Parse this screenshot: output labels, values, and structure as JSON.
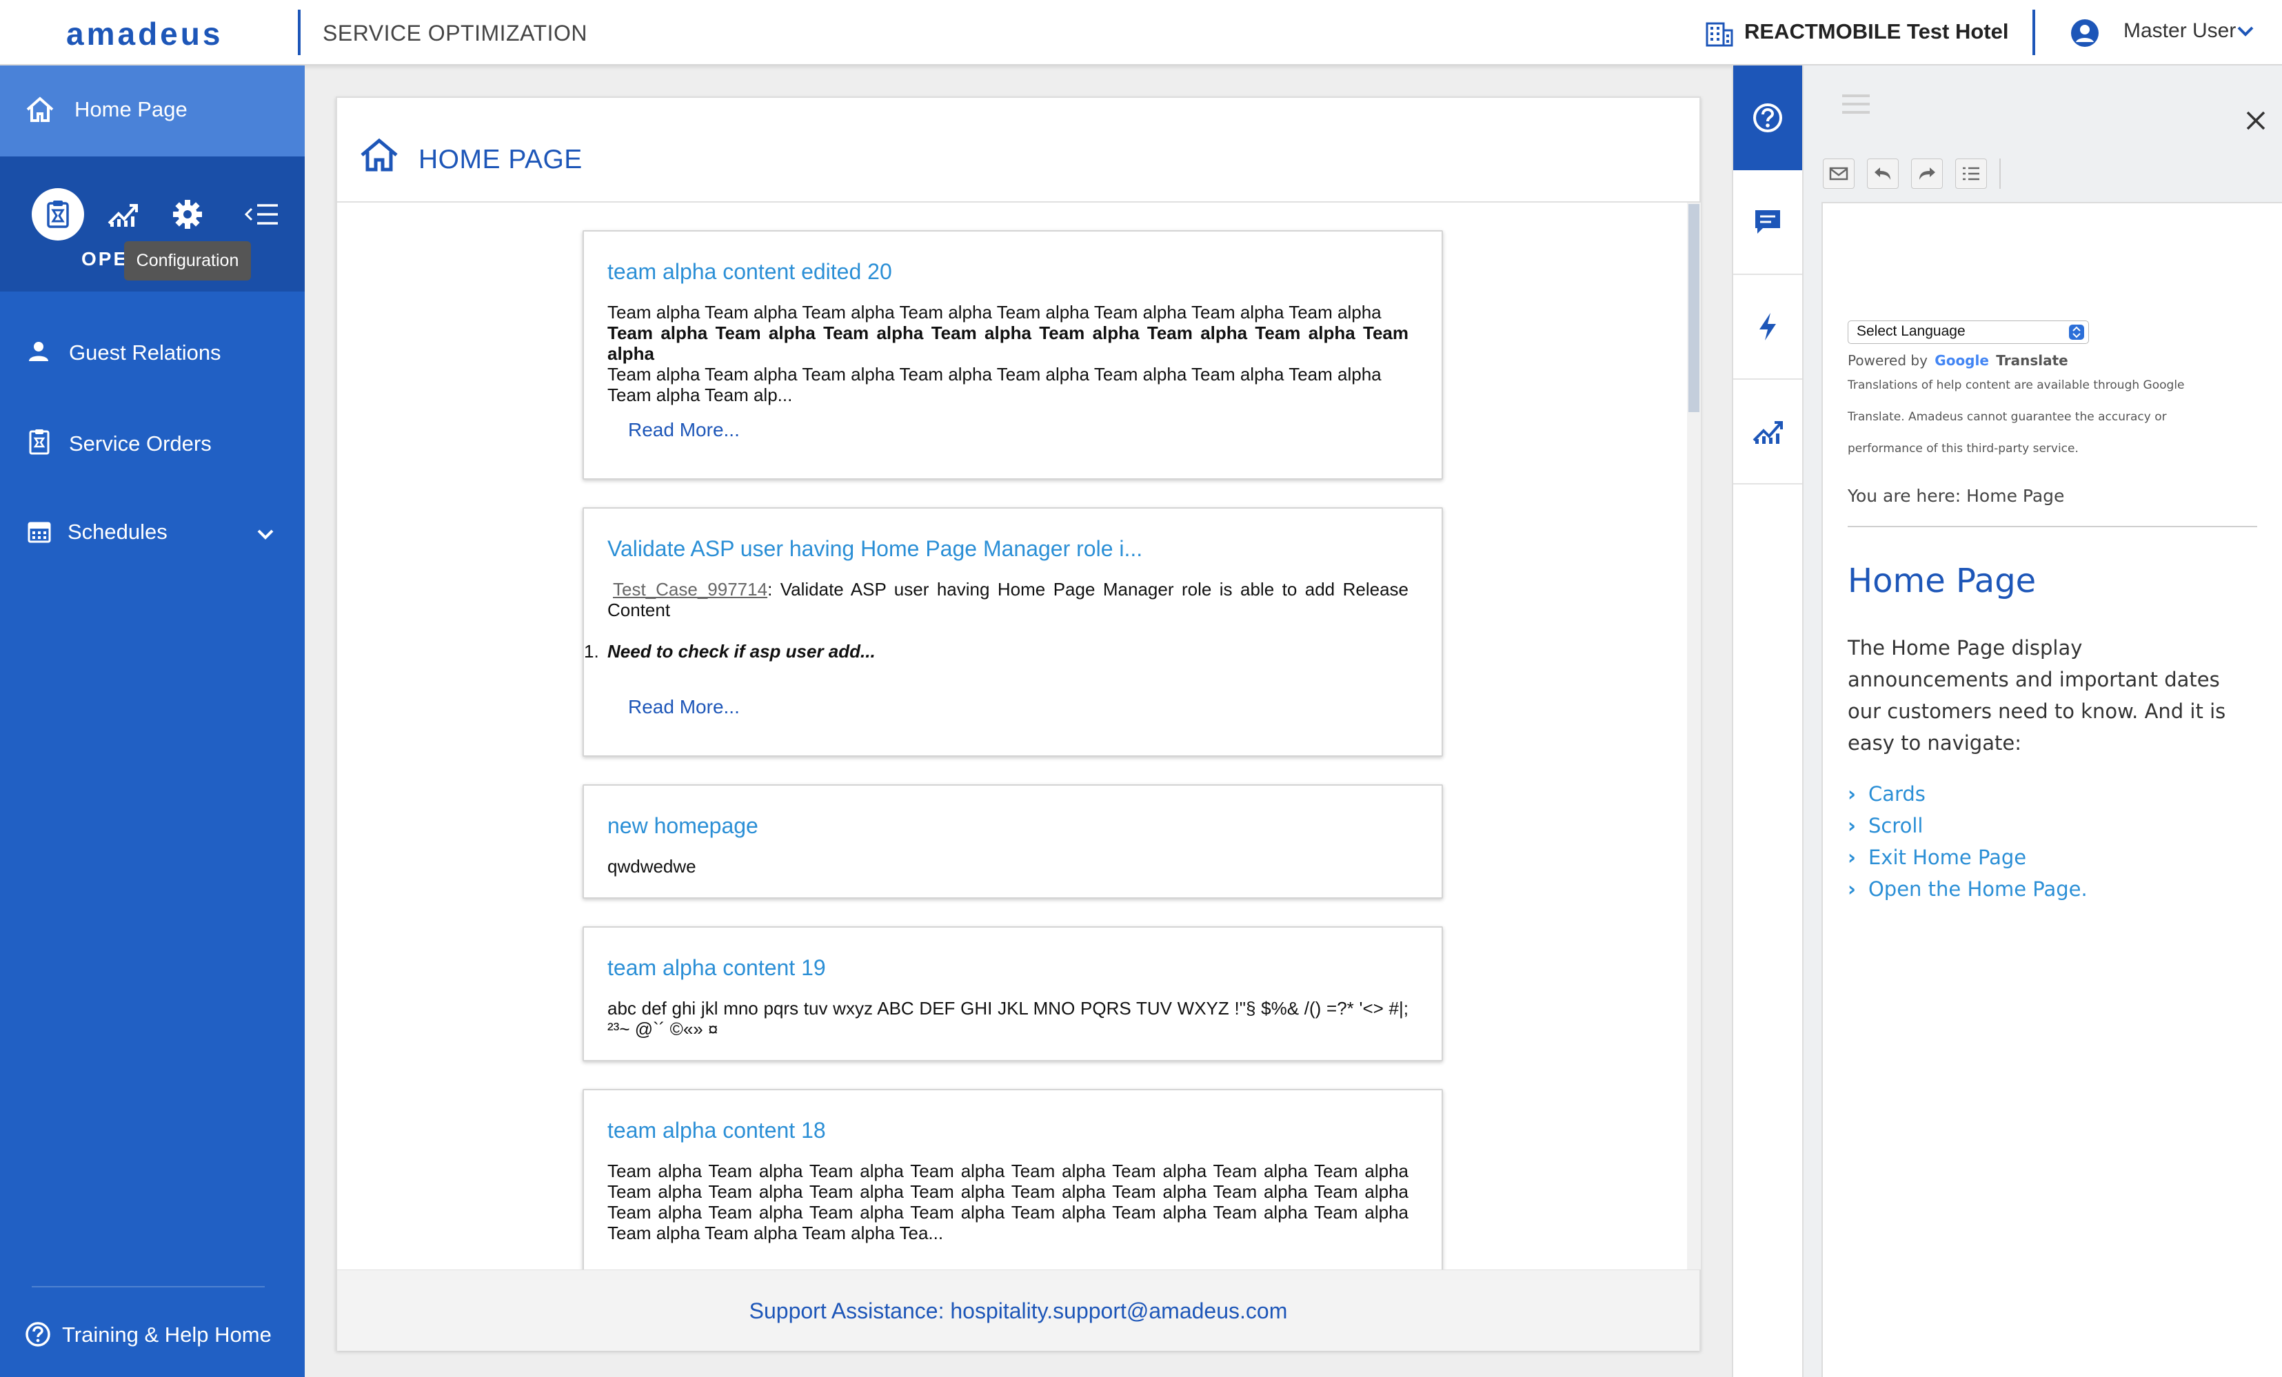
{
  "header": {
    "logo": "amadeus",
    "app_title": "SERVICE OPTIMIZATION",
    "hotel": "REACTMOBILE Test Hotel",
    "user": "Master User"
  },
  "sidebar": {
    "home": "Home Page",
    "tooltip": "Configuration",
    "section_partial": "OPE",
    "items": [
      {
        "label": "Guest Relations"
      },
      {
        "label": "Service Orders"
      },
      {
        "label": "Schedules"
      }
    ],
    "help_home": "Training & Help Home"
  },
  "main": {
    "title": "HOME PAGE",
    "cards": [
      {
        "title": "team alpha content edited 20",
        "body_line1": "Team alpha Team alpha Team alpha Team alpha Team alpha Team alpha Team alpha Team alpha",
        "body_line2": "Team alpha Team alpha Team alpha Team alpha Team alpha Team alpha Team alpha Team alpha",
        "body_line3": "Team alpha Team alpha Team alpha Team alpha Team alpha Team alpha Team alpha Team alpha",
        "body_line4": "Team alpha Team alp...",
        "read_more": "Read More..."
      },
      {
        "title": "Validate ASP user having Home Page Manager role i...",
        "test_case": "Test_Case_997714",
        "body": ": Validate ASP user having Home Page Manager role is able to add Release Content",
        "list_num": "1.",
        "list_item": "Need to check if asp user add...",
        "read_more": "Read More..."
      },
      {
        "title": "new homepage",
        "body": "qwdwedwe"
      },
      {
        "title": "team alpha content 19",
        "body": "abc def ghi jkl mno pqrs tuv wxyz ABC DEF GHI JKL MNO PQRS TUV WXYZ !\"§ $%& /() =?* '<> #|; ²³~ @`´ ©«» ¤"
      },
      {
        "title": "team alpha content 18",
        "body": "Team alpha Team alpha Team alpha Team alpha Team alpha Team alpha Team alpha Team alpha Team alpha Team alpha Team alpha Team alpha Team alpha Team alpha Team alpha Team alpha Team alpha Team alpha Team alpha Team alpha Team alpha Team alpha Team alpha Team alpha Team alpha Team alpha Team alpha Tea..."
      }
    ],
    "support": "Support Assistance: hospitality.support@amadeus.com"
  },
  "help": {
    "language_select": "Select Language",
    "powered_by": "Powered by",
    "google": "Google",
    "translate": "Translate",
    "disclaimer_1": "Translations of help content are available through Google",
    "disclaimer_2": "Translate. Amadeus cannot guarantee the accuracy or",
    "disclaimer_3": "performance of this third-party service.",
    "breadcrumb": "You are here: Home Page",
    "title": "Home Page",
    "description": "The Home Page display announcements and important dates our customers need to know. And it is easy to navigate:",
    "links": [
      "Cards",
      "Scroll",
      "Exit Home Page",
      "Open the Home Page."
    ]
  },
  "colors": {
    "brand": "#1d56b8",
    "sidebar": "#2160c4",
    "link": "#2b8fd6"
  }
}
